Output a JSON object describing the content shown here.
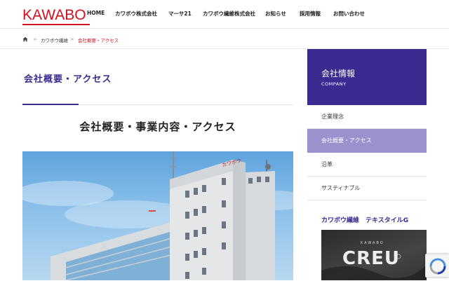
{
  "header": {
    "logo_text": "KAWABO",
    "nav": [
      "HOME",
      "カワボウ株式会社",
      "マーサ21",
      "カワボウ繊維株式会社",
      "お知らせ",
      "採用情報",
      "お問い合わせ"
    ]
  },
  "breadcrumb": {
    "items": [
      "カワボウ繊維",
      "会社概要・アクセス"
    ],
    "separator": ">"
  },
  "page": {
    "title": "会社概要・アクセス",
    "section_heading": "会社概要・事業内容・アクセス",
    "building_sign": "カワボウ"
  },
  "sidebar": {
    "title": "会社情報",
    "subtitle": "COMPANY",
    "items": [
      {
        "label": "企業理念",
        "active": false
      },
      {
        "label": "会社概要・アクセス",
        "active": true
      },
      {
        "label": "沿革",
        "active": false
      },
      {
        "label": "サスティナブル",
        "active": false
      }
    ],
    "banner_title": "カワボウ繊維　テキスタイルG",
    "banner_small": "KAWABO",
    "banner_big": "CREU"
  },
  "colors": {
    "brand_red": "#d4121e",
    "accent_purple": "#3b2a8f",
    "active_item": "#9b91cc"
  },
  "icons": {
    "home": "home-icon",
    "recaptcha": "recaptcha-icon"
  }
}
